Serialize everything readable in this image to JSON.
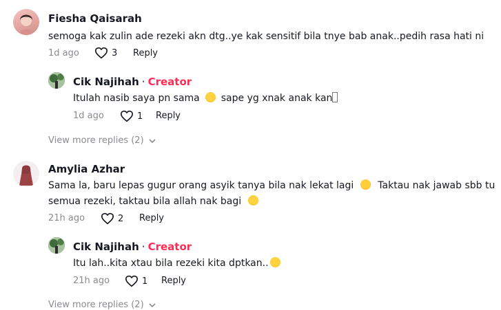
{
  "comments": [
    {
      "author": "Fiesha Qaisarah",
      "text": "semoga kak zulin ade rezeki akn dtg..ye kak sensitif bila tnye bab anak..pedih rasa hati ni",
      "time": "1d ago",
      "likes": "3",
      "reply_label": "Reply",
      "avatar_icon": "avatar-photo",
      "replies": [
        {
          "author": "Cik Najihah",
          "separator": "·",
          "badge": "Creator",
          "text_before": "Itulah nasib saya pn sama",
          "text_after": "sape yg xnak anak kan",
          "time": "1d ago",
          "likes": "1",
          "reply_label": "Reply"
        }
      ],
      "view_more": "View more replies (2)"
    },
    {
      "author": "Amylia Azhar",
      "text_line1": "Sama la, baru lepas gugur orang asyik tanya bila nak lekat lagi",
      "text_line1_after": "Taktau nak jawab sbb tu",
      "text_line2": "semua rezeki, taktau bila allah nak bagi",
      "time": "21h ago",
      "likes": "2",
      "reply_label": "Reply",
      "replies": [
        {
          "author": "Cik Najihah",
          "separator": "·",
          "badge": "Creator",
          "text": "Itu lah..kita xtau bila rezeki kita dptkan..",
          "time": "21h ago",
          "likes": "1",
          "reply_label": "Reply"
        }
      ],
      "view_more": "View more replies (2)"
    }
  ],
  "colors": {
    "creator": "#fe2c55",
    "muted": "#8a8b91",
    "text": "#161823"
  },
  "icons": {
    "like": "heart-outline-icon",
    "expand": "chevron-down-icon"
  }
}
